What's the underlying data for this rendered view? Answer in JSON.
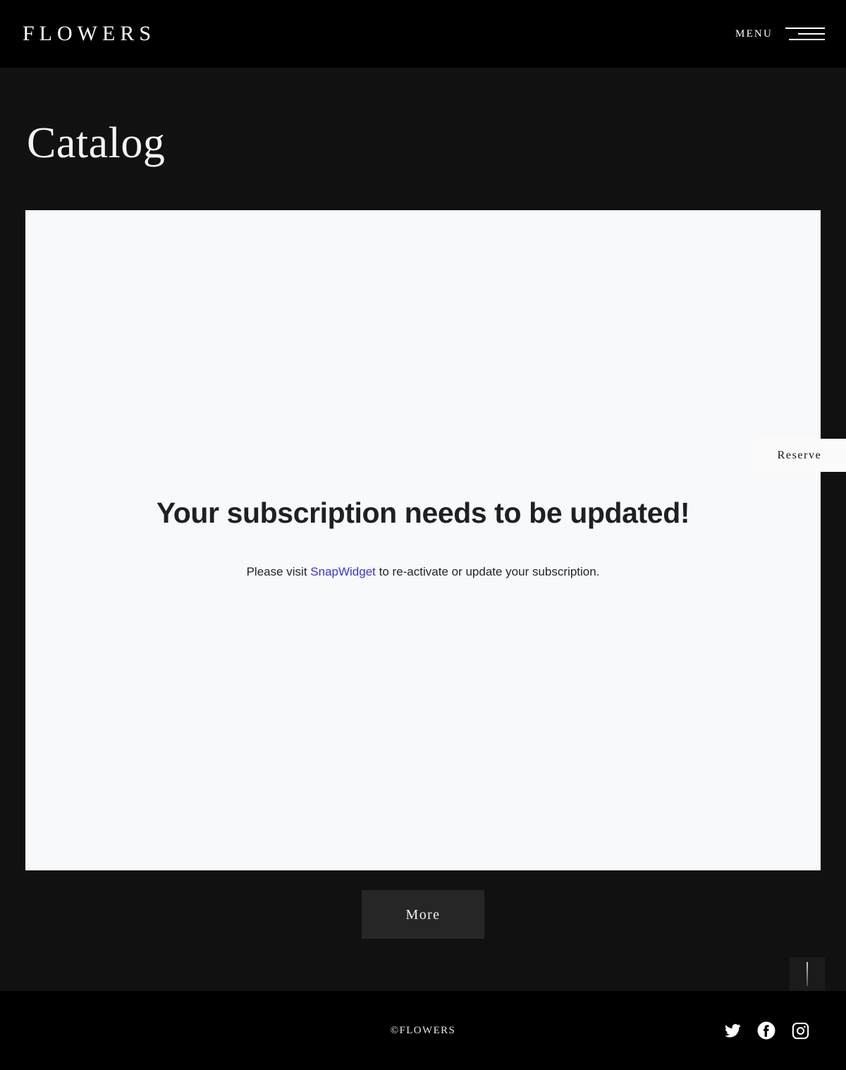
{
  "header": {
    "brand": "FLOWERS",
    "menu_label": "MENU",
    "menu_icon": "hamburger-icon",
    "background": "#000000"
  },
  "page": {
    "title": "Catalog",
    "background": "#111111"
  },
  "widget": {
    "heading": "Your subscription needs to be updated!",
    "message_prefix": "Please visit ",
    "link_text": "SnapWidget",
    "message_suffix": " to re-activate or update your subscription.",
    "link_color": "#3b34d6",
    "background": "#f8f9fa"
  },
  "reserve": {
    "label": "Reserve",
    "background": "#fbfbfb"
  },
  "more": {
    "label": "More",
    "background": "#262626"
  },
  "scroll_top": {
    "icon": "scroll-to-top-icon"
  },
  "footer": {
    "copyright": "©FLOWERS",
    "background": "#000000",
    "social": [
      {
        "name": "twitter-icon",
        "label": "Twitter"
      },
      {
        "name": "facebook-icon",
        "label": "Facebook"
      },
      {
        "name": "instagram-icon",
        "label": "Instagram"
      }
    ]
  }
}
